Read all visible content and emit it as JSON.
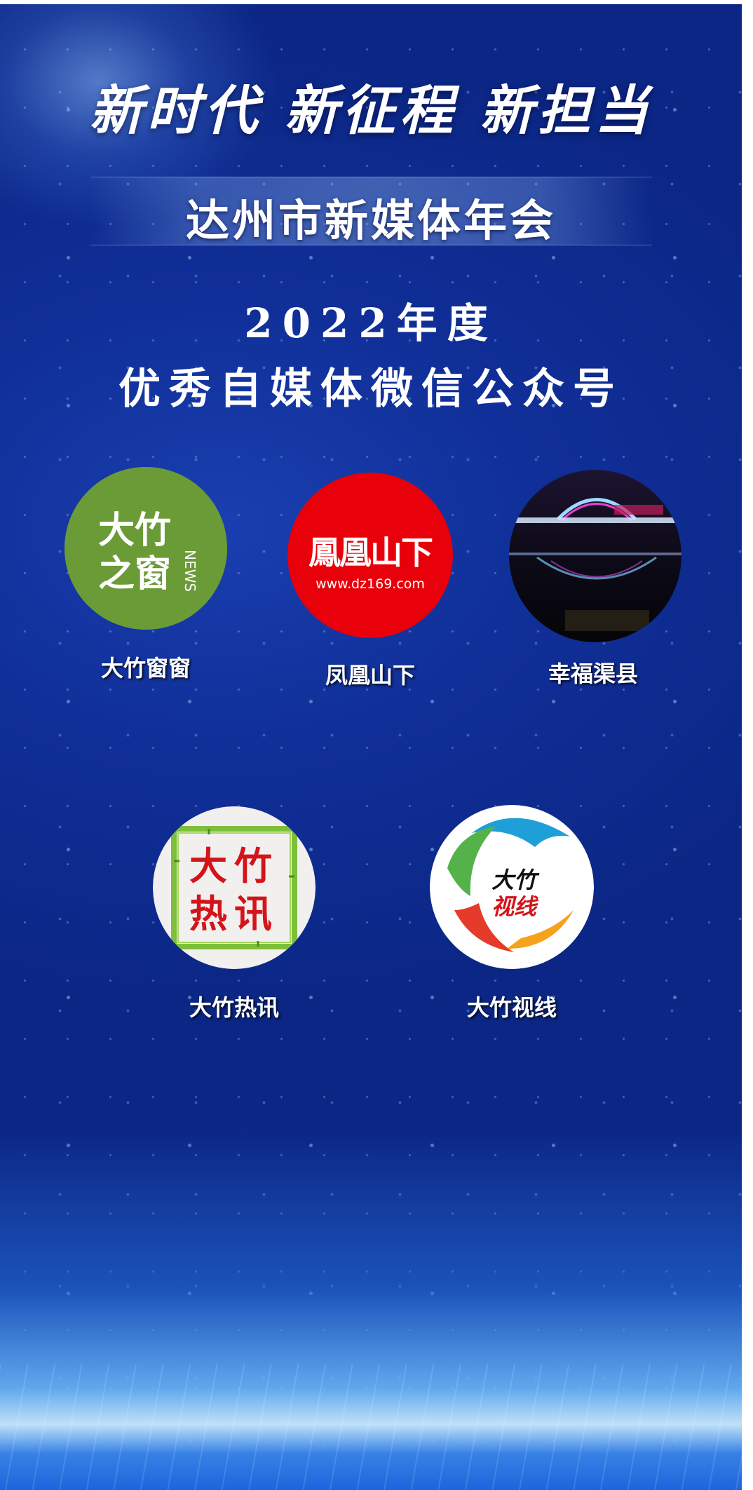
{
  "poster": {
    "slogan": "新时代 新征程 新担当",
    "event_title": "达州市新媒体年会",
    "award_year": "2022年度",
    "award_category": "优秀自媒体微信公众号"
  },
  "accounts": [
    {
      "name": "大竹窗窗",
      "logo": {
        "icon": "dazhu-window-news-logo",
        "text_main": "大竹之窗",
        "text_side": "NEWS",
        "color": "#6b9b37"
      }
    },
    {
      "name": "凤凰山下",
      "logo": {
        "icon": "fenghuangshanxia-logo",
        "text_main": "凤凰山下",
        "url": "www.dz169.com",
        "color": "#e8000b"
      }
    },
    {
      "name": "幸福渠县",
      "logo": {
        "icon": "night-bridge-photo",
        "color": "#120d1c"
      }
    },
    {
      "name": "大竹热讯",
      "logo": {
        "icon": "bamboo-frame-logo",
        "text_line1": "大竹",
        "text_line2": "热讯",
        "color": "#d3141b"
      }
    },
    {
      "name": "大竹视线",
      "logo": {
        "icon": "dazhu-vision-logo",
        "text_line1": "大竹",
        "text_line2": "视线",
        "color": "#1f9fd8"
      }
    }
  ]
}
